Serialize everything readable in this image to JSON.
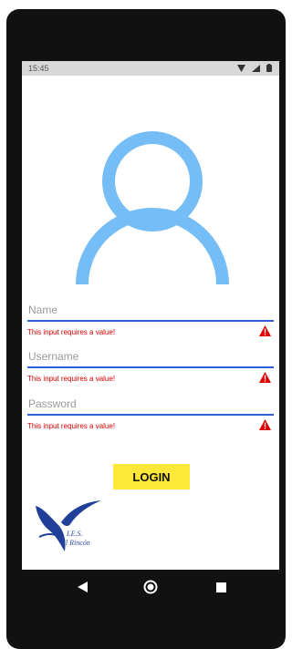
{
  "status_bar": {
    "time": "15:45",
    "icons": [
      "wifi-icon",
      "signal-icon",
      "battery-icon"
    ]
  },
  "avatar": {
    "icon": "user-avatar-icon",
    "color": "#75bdf6"
  },
  "form": {
    "name": {
      "placeholder": "Name",
      "value": "",
      "error": "This input requires a value!"
    },
    "username": {
      "placeholder": "Username",
      "value": "",
      "error": "This input requires a value!"
    },
    "password": {
      "placeholder": "Password",
      "value": "",
      "error": "This input requires a value!"
    },
    "error_color": "#e00000",
    "line_color": "#2f5fd6"
  },
  "login_button": {
    "label": "LOGIN",
    "color": "#fde83a"
  },
  "logo": {
    "line1": "I.E.S.",
    "line2": "El Rincón"
  },
  "nav_bar": {
    "icons": [
      "back-icon",
      "home-icon",
      "recents-icon"
    ]
  }
}
